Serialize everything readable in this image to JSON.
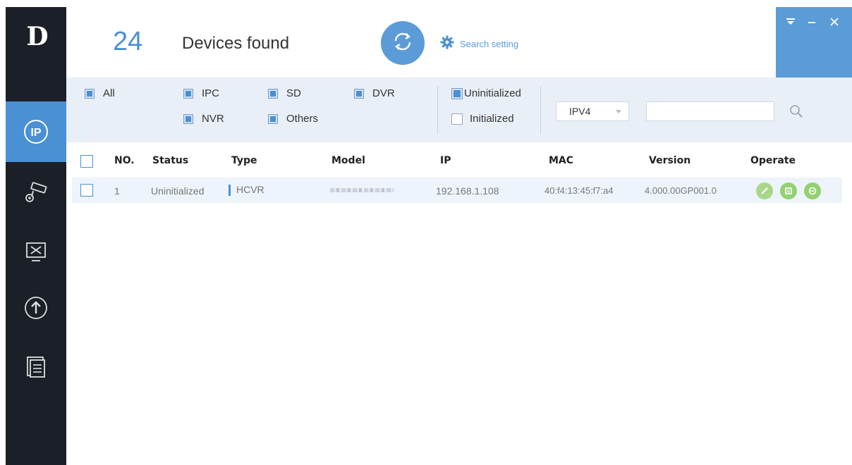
{
  "sidebar": {
    "logo": "D",
    "items": [
      {
        "name": "ip-icon",
        "active": true
      },
      {
        "name": "camera-settings-icon",
        "active": false
      },
      {
        "name": "system-tools-icon",
        "active": false
      },
      {
        "name": "upgrade-icon",
        "active": false
      },
      {
        "name": "document-icon",
        "active": false
      }
    ]
  },
  "header": {
    "count": "24",
    "found_label": "Devices found",
    "search_setting_label": "Search setting"
  },
  "window_controls": {
    "menu": "▾",
    "minimize": "−",
    "close": "✕"
  },
  "filters": {
    "all": "All",
    "ipc": "IPC",
    "sd": "SD",
    "dvr": "DVR",
    "nvr": "NVR",
    "others": "Others",
    "uninitialized": "Uninitialized",
    "initialized": "Initialized",
    "ip_version": "IPV4",
    "search_value": ""
  },
  "table": {
    "columns": [
      "NO.",
      "Status",
      "Type",
      "Model",
      "IP",
      "MAC",
      "Version",
      "Operate"
    ],
    "rows": [
      {
        "no": "1",
        "status": "Uninitialized",
        "type": "HCVR",
        "ip": "192.168.1.108",
        "mac": "40:f4:13:45:f7:a4",
        "version": "4.000.00GP001.0"
      }
    ]
  },
  "colors": {
    "accent": "#4a90d4",
    "sidebar": "#1b2028",
    "filter_bg": "#e9eff6",
    "op_edit": "#9ed07a",
    "op_detail": "#8fce73",
    "op_web": "#8fce73"
  }
}
